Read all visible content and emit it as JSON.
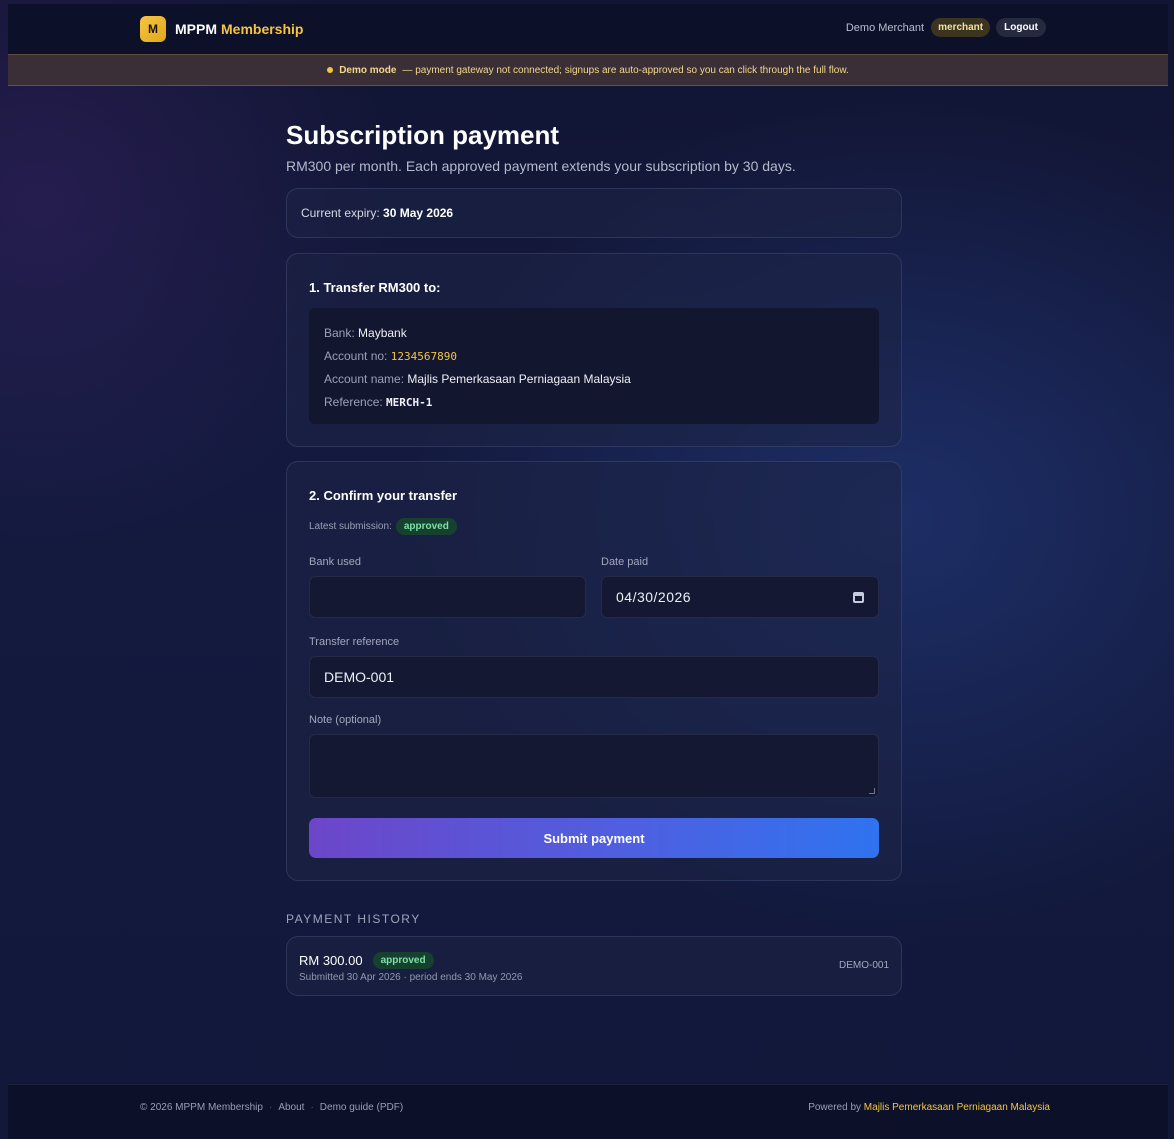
{
  "header": {
    "logo_letter": "M",
    "brand_name": "MPPM",
    "brand_accent": "Membership",
    "user_name": "Demo Merchant",
    "role": "merchant",
    "logout_label": "Logout"
  },
  "demo_banner": {
    "strong": "Demo mode",
    "message": "— payment gateway not connected; signups are auto-approved so you can click through the full flow."
  },
  "page": {
    "title": "Subscription payment",
    "subtitle": "RM300 per month. Each approved payment extends your subscription by 30 days."
  },
  "expiry": {
    "label": "Current expiry:",
    "value": "30 May 2026"
  },
  "transfer": {
    "title": "1. Transfer RM300 to:",
    "bank_label": "Bank:",
    "bank_value": "Maybank",
    "account_no_label": "Account no:",
    "account_no_value": "1234567890",
    "account_name_label": "Account name:",
    "account_name_value": "Majlis Pemerkasaan Perniagaan Malaysia",
    "reference_label": "Reference:",
    "reference_value": "MERCH-1"
  },
  "confirm": {
    "title": "2. Confirm your transfer",
    "latest_label": "Latest submission:",
    "latest_status": "approved",
    "bank_used_label": "Bank used",
    "bank_used_value": "",
    "date_paid_label": "Date paid",
    "date_paid_value": "04/30/2026",
    "transfer_ref_label": "Transfer reference",
    "transfer_ref_value": "DEMO-001",
    "note_label": "Note (optional)",
    "note_value": "",
    "submit_label": "Submit payment"
  },
  "history": {
    "title": "PAYMENT HISTORY",
    "items": [
      {
        "amount": "RM 300.00",
        "status": "approved",
        "meta": "Submitted 30 Apr 2026 · period ends 30 May 2026",
        "reference": "DEMO-001"
      }
    ]
  },
  "footer": {
    "copyright": "© 2026 MPPM Membership",
    "separator": "·",
    "about": "About",
    "demo_guide": "Demo guide (PDF)",
    "powered_by": "Powered by",
    "org": "Majlis Pemerkasaan Perniagaan Malaysia"
  },
  "colors": {
    "accent": "#f5c542",
    "approved_bg": "#17412f",
    "approved_text": "#7fe0a8",
    "button_start": "#6c46c9",
    "button_end": "#2f73ef"
  }
}
